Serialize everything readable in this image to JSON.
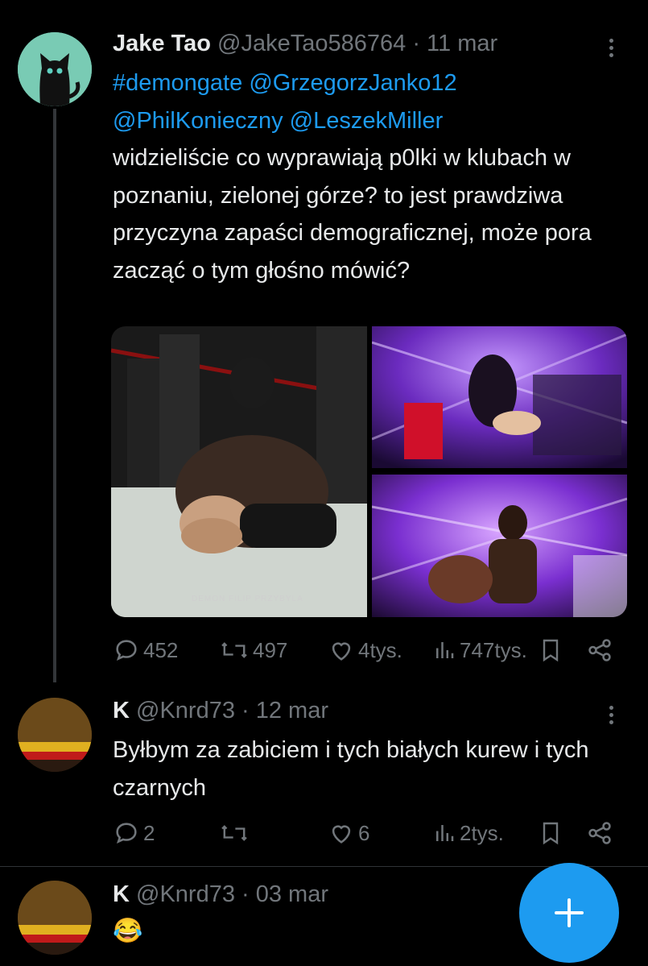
{
  "tweets": [
    {
      "author": "Jake Tao",
      "handle": "@JakeTao586764",
      "date": "· 11 mar",
      "hashtag": "#demongate",
      "mention1": "@GrzegorzJanko12",
      "mention2": "@PhilKonieczny",
      "mention3": "@LeszekMiller",
      "text": "widzieliście co wyprawiają p0lki w klubach w poznaniu, zielonej górze? to jest prawdziwa przyczyna zapaści demograficznej, może pora zacząć o tym głośno mówić?",
      "watermark": "DEMON FILIP PRZYBYLA",
      "replies": "452",
      "reposts": "497",
      "likes": "4tys.",
      "views": "747tys."
    },
    {
      "author": "K",
      "handle": "@Knrd73",
      "date": "· 12 mar",
      "text": "Byłbym za zabiciem i tych białych kurew i tych czarnych",
      "replies": "2",
      "reposts": "",
      "likes": "6",
      "views": "2tys."
    },
    {
      "author": "K",
      "handle": "@Knrd73",
      "date": "· 03 mar",
      "text": "😂"
    }
  ],
  "colors": {
    "accent": "#1d9bf0",
    "muted": "#71767b",
    "text": "#e7e9ea",
    "bg": "#000000"
  },
  "icons": [
    "reply-icon",
    "repost-icon",
    "like-icon",
    "views-icon",
    "bookmark-icon",
    "share-icon",
    "compose-plus-icon"
  ]
}
